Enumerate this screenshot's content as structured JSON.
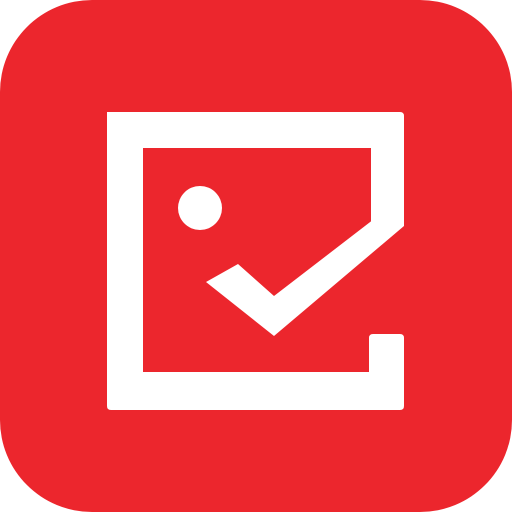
{
  "icon": {
    "name": "photo-check-app-icon",
    "background_color": "#EC262D",
    "glyph_color": "#FFFFFF"
  }
}
